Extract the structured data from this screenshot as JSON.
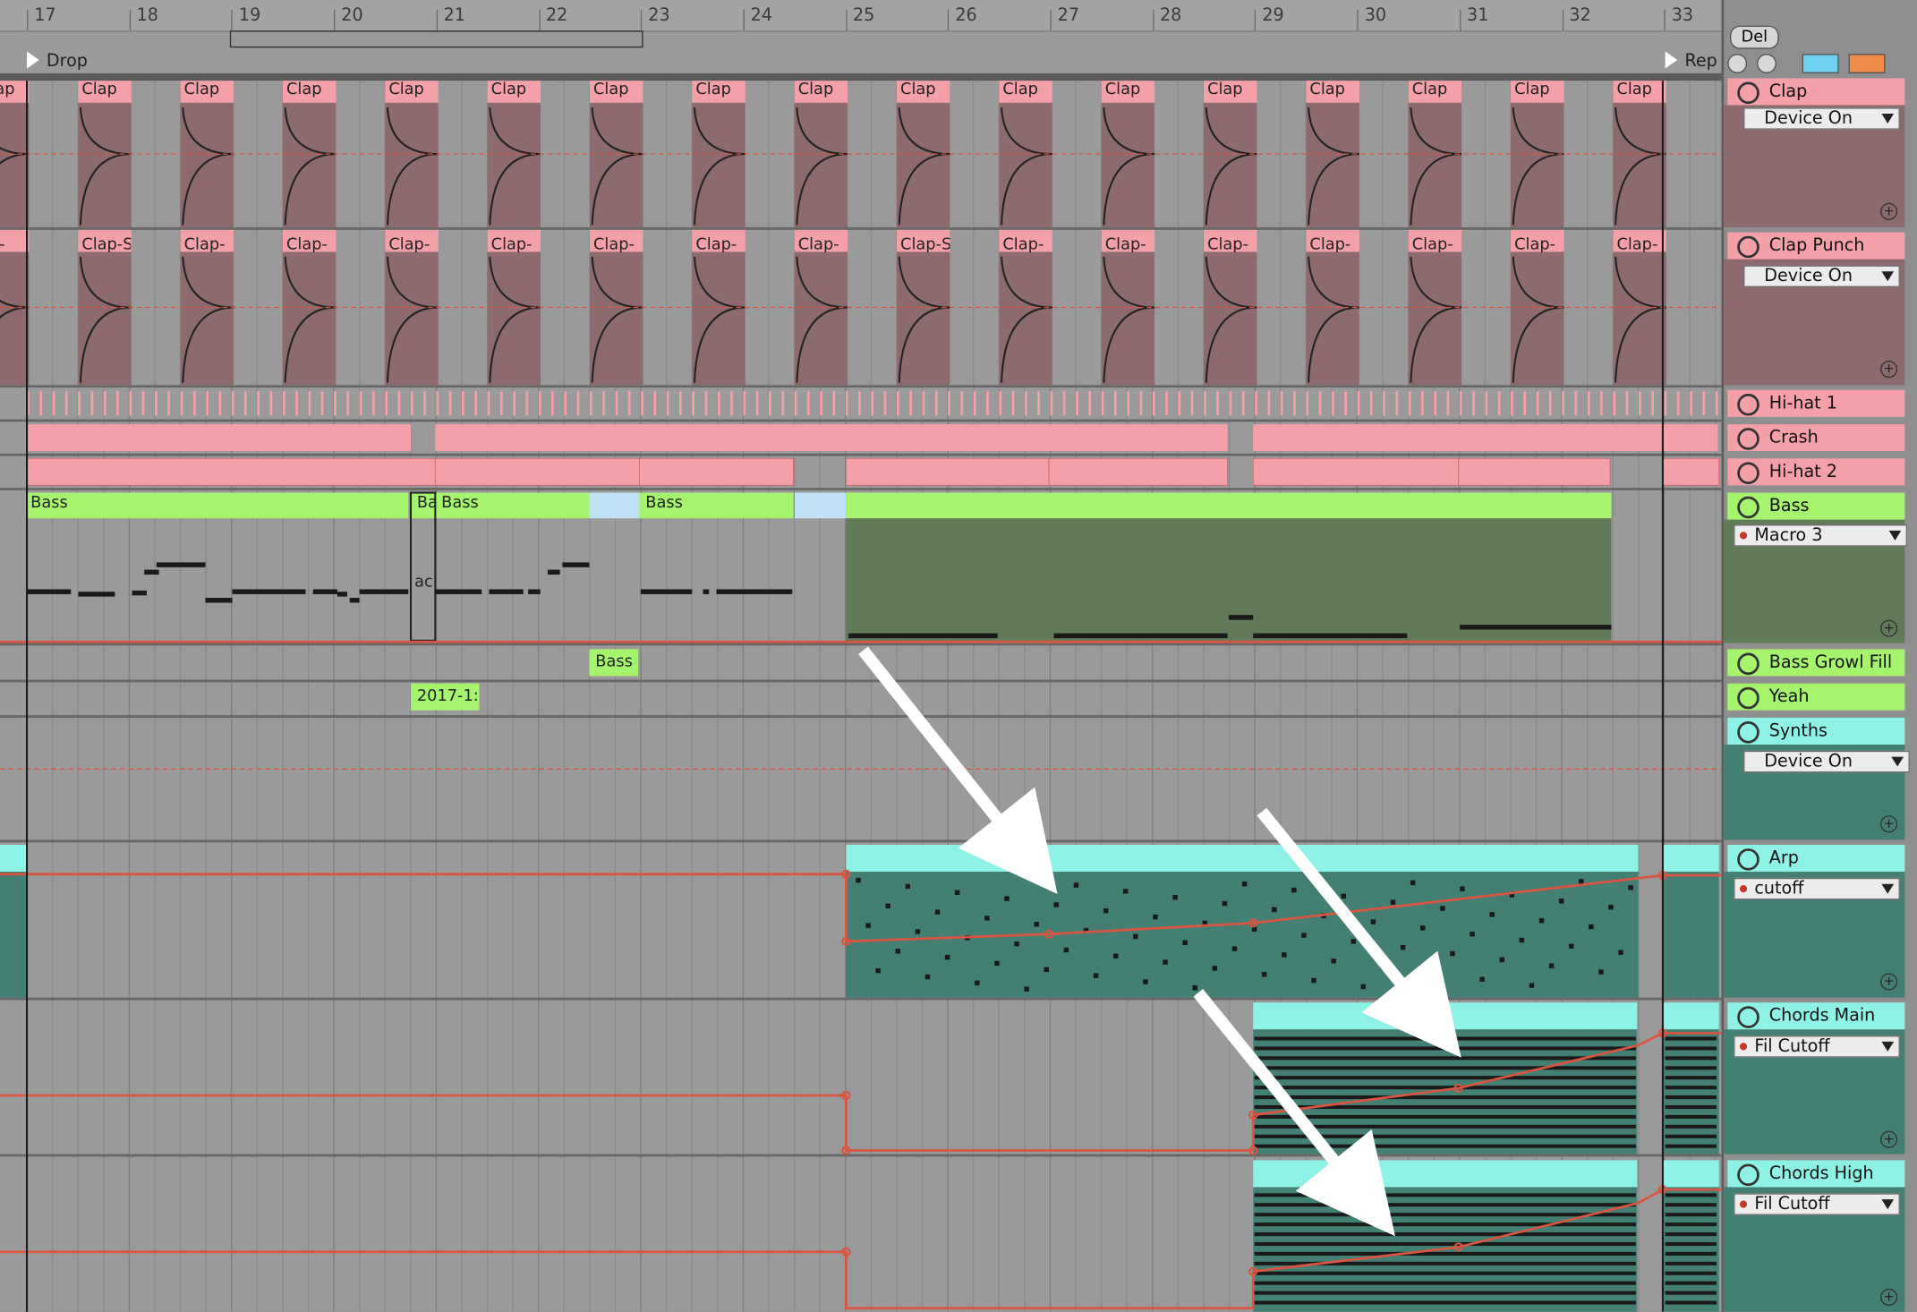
{
  "ruler": {
    "bars": [
      "17",
      "18",
      "19",
      "20",
      "21",
      "22",
      "23",
      "24",
      "25",
      "26",
      "27",
      "28",
      "29",
      "30",
      "31",
      "32",
      "33"
    ]
  },
  "locators": {
    "drop": "Drop",
    "rep": "Rep"
  },
  "top_controls": {
    "del_label": "Del"
  },
  "clap_row": {
    "clip_label": "Clap"
  },
  "clap_punch_row": {
    "clip_labels": [
      "ap-",
      "Clap-S",
      "Clap-",
      "Clap-",
      "Clap-",
      "Clap-",
      "Clap-",
      "Clap-",
      "Clap-",
      "Clap-S",
      "Clap-",
      "Clap-",
      "Clap-",
      "Clap-",
      "Clap-",
      "Clap-",
      "Clap-"
    ]
  },
  "bass_row": {
    "clips": [
      "Bass",
      "Ba",
      "Bass",
      "Bass"
    ],
    "overlay": "ac"
  },
  "small_clips": {
    "bass_small": "Bass",
    "date_clip": "2017-1:"
  },
  "tracks": [
    {
      "name": "Clap",
      "device": "Device On"
    },
    {
      "name": "Clap Punch",
      "device": "Device On"
    },
    {
      "name": "Hi-hat 1"
    },
    {
      "name": "Crash"
    },
    {
      "name": "Hi-hat 2"
    },
    {
      "name": "Bass",
      "device": "Macro 3"
    },
    {
      "name": "Bass Growl Fill"
    },
    {
      "name": "Yeah"
    },
    {
      "name": "Synths",
      "device": "Device On"
    },
    {
      "name": "Arp",
      "device": "cutoff"
    },
    {
      "name": "Chords Main",
      "device": "Fil Cutoff"
    },
    {
      "name": "Chords High",
      "device": "Fil Cutoff"
    }
  ],
  "colors": {
    "drums": "#f4a0a8",
    "drums_dark": "#8c6a6e",
    "bass": "#a6f46e",
    "bass_dark": "#617a57",
    "synth": "#8ff2e6",
    "synth_dark": "#447f74",
    "automation": "#d9553f"
  }
}
